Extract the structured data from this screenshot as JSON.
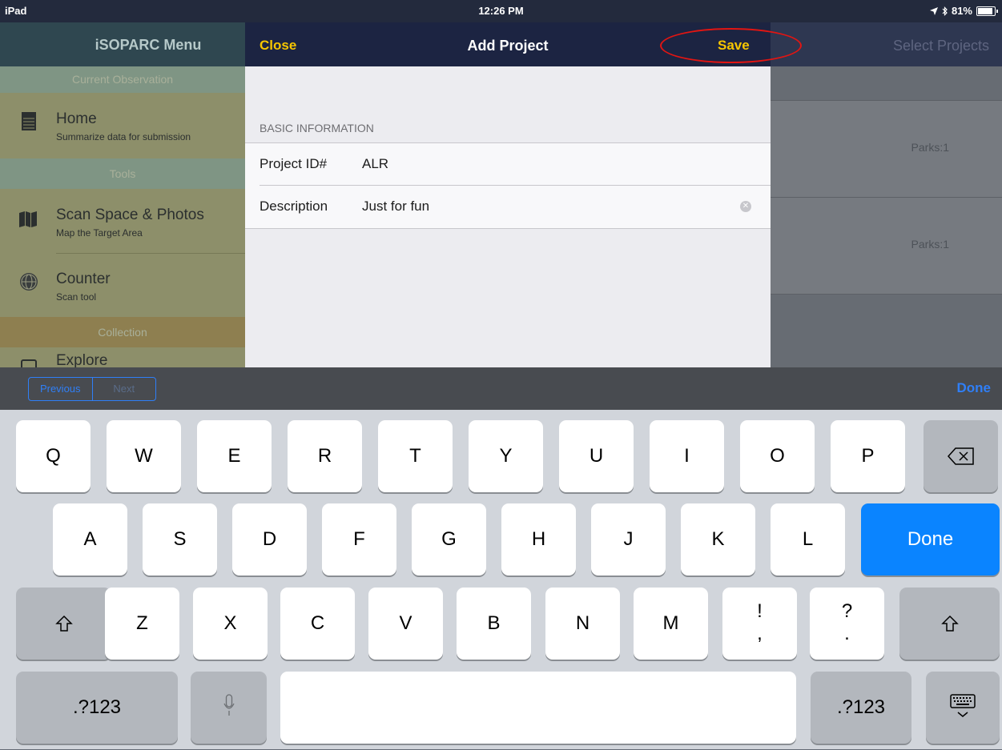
{
  "status_bar": {
    "device": "iPad",
    "time": "12:26 PM",
    "battery": "81%"
  },
  "sidebar": {
    "title": "iSOPARC Menu",
    "sections": {
      "current": "Current Observation",
      "tools": "Tools",
      "collection": "Collection"
    },
    "items": [
      {
        "title": "Home",
        "subtitle": "Summarize data for submission"
      },
      {
        "title": "Scan Space & Photos",
        "subtitle": "Map the Target Area"
      },
      {
        "title": "Counter",
        "subtitle": "Scan tool"
      },
      {
        "title": "Explore",
        "subtitle": ""
      }
    ]
  },
  "background_panel": {
    "title": "Select Projects",
    "cells": [
      "Parks:1",
      "Parks:1"
    ]
  },
  "modal": {
    "close_label": "Close",
    "title": "Add Project",
    "save_label": "Save",
    "group_label": "BASIC INFORMATION",
    "fields": [
      {
        "label": "Project ID#",
        "value": "ALR"
      },
      {
        "label": "Description",
        "value": "Just for fun"
      }
    ]
  },
  "accessory": {
    "previous": "Previous",
    "next": "Next",
    "done": "Done"
  },
  "keyboard": {
    "row1": [
      "Q",
      "W",
      "E",
      "R",
      "T",
      "Y",
      "U",
      "I",
      "O",
      "P"
    ],
    "row2": [
      "A",
      "S",
      "D",
      "F",
      "G",
      "H",
      "J",
      "K",
      "L"
    ],
    "row3": [
      "Z",
      "X",
      "C",
      "V",
      "B",
      "N",
      "M"
    ],
    "punc1": [
      "!",
      ","
    ],
    "punc2": [
      "?",
      "."
    ],
    "done": "Done",
    "numbers": ".?123"
  },
  "colors": {
    "nav_accent": "#f7c600",
    "highlight": "#e21512",
    "ios_blue": "#0a84ff"
  }
}
